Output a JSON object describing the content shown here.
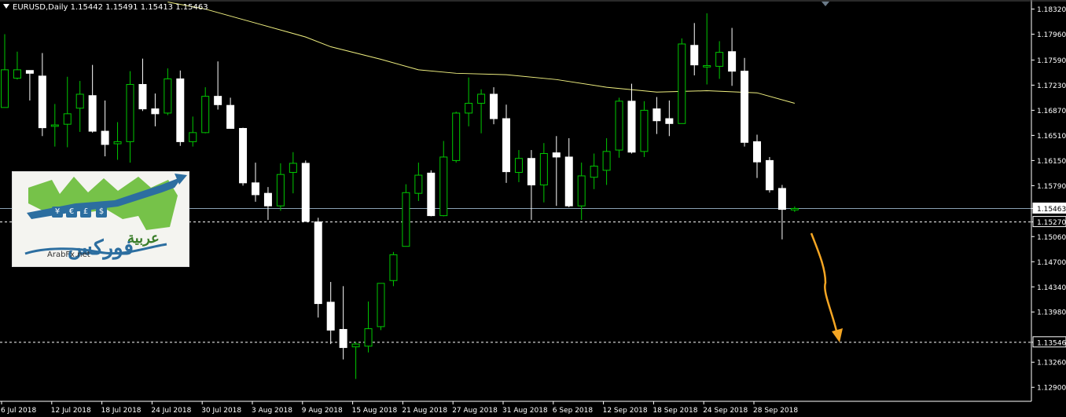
{
  "header": {
    "symbol": "EURUSD,Daily",
    "ohlc": "1.15442 1.15491 1.15413 1.15463"
  },
  "logo": {
    "arabic_top": "عربية",
    "arabic_main": "فوركس",
    "site": "ArabFx.net",
    "currency_symbols": [
      "¥",
      "€",
      "£",
      "$"
    ]
  },
  "colors": {
    "background": "#000000",
    "axis": "#ffffff",
    "bull_candle": "#000000",
    "bull_border": "#00c800",
    "bear_candle": "#ffffff",
    "ma_line": "#f0f080",
    "current_price_line": "#8aa0b4",
    "annotation_arrow": "#f5a623"
  },
  "chart_data": {
    "type": "candlestick",
    "ylim": [
      1.127,
      1.1845
    ],
    "y_tick_labels": [
      "1.18320",
      "1.17960",
      "1.17590",
      "1.17230",
      "1.16870",
      "1.16510",
      "1.16150",
      "1.15790",
      "1.15463",
      "1.15270",
      "1.15060",
      "1.14700",
      "1.14340",
      "1.13980",
      "1.13546",
      "1.13260",
      "1.12900"
    ],
    "y_tick_values": [
      1.1832,
      1.1796,
      1.1759,
      1.1723,
      1.1687,
      1.1651,
      1.1615,
      1.1579,
      1.15463,
      1.1527,
      1.1506,
      1.147,
      1.1434,
      1.1398,
      1.13546,
      1.1326,
      1.129
    ],
    "x_tick_labels": [
      "6 Jul 2018",
      "12 Jul 2018",
      "18 Jul 2018",
      "24 Jul 2018",
      "30 Jul 2018",
      "3 Aug 2018",
      "9 Aug 2018",
      "15 Aug 2018",
      "21 Aug 2018",
      "27 Aug 2018",
      "31 Aug 2018",
      "6 Sep 2018",
      "12 Sep 2018",
      "18 Sep 2018",
      "24 Sep 2018",
      "28 Sep 2018"
    ],
    "x_tick_index": [
      0,
      4,
      8,
      12,
      16,
      20,
      24,
      28,
      32,
      36,
      40,
      44,
      48,
      52,
      56,
      60
    ],
    "current_price": 1.15463,
    "horizontal_levels": [
      1.1527,
      1.13546
    ],
    "candles": [
      {
        "o": 1.1691,
        "h": 1.1796,
        "l": 1.1691,
        "c": 1.1745
      },
      {
        "o": 1.1733,
        "h": 1.1771,
        "l": 1.1731,
        "c": 1.1745
      },
      {
        "o": 1.1744,
        "h": 1.1744,
        "l": 1.1701,
        "c": 1.174
      },
      {
        "o": 1.1736,
        "h": 1.1769,
        "l": 1.165,
        "c": 1.1662
      },
      {
        "o": 1.1664,
        "h": 1.1696,
        "l": 1.1635,
        "c": 1.1666
      },
      {
        "o": 1.1667,
        "h": 1.1735,
        "l": 1.1634,
        "c": 1.1682
      },
      {
        "o": 1.169,
        "h": 1.1729,
        "l": 1.1656,
        "c": 1.171
      },
      {
        "o": 1.1708,
        "h": 1.1752,
        "l": 1.1655,
        "c": 1.1657
      },
      {
        "o": 1.1657,
        "h": 1.1701,
        "l": 1.1621,
        "c": 1.1638
      },
      {
        "o": 1.1639,
        "h": 1.167,
        "l": 1.1616,
        "c": 1.1642
      },
      {
        "o": 1.1642,
        "h": 1.1743,
        "l": 1.1612,
        "c": 1.1724
      },
      {
        "o": 1.1724,
        "h": 1.1761,
        "l": 1.1686,
        "c": 1.1689
      },
      {
        "o": 1.1689,
        "h": 1.1711,
        "l": 1.1664,
        "c": 1.1682
      },
      {
        "o": 1.1683,
        "h": 1.1747,
        "l": 1.168,
        "c": 1.1732
      },
      {
        "o": 1.1732,
        "h": 1.1744,
        "l": 1.1636,
        "c": 1.1642
      },
      {
        "o": 1.1642,
        "h": 1.1678,
        "l": 1.1635,
        "c": 1.1655
      },
      {
        "o": 1.1655,
        "h": 1.172,
        "l": 1.1654,
        "c": 1.1707
      },
      {
        "o": 1.1707,
        "h": 1.1757,
        "l": 1.1688,
        "c": 1.1695
      },
      {
        "o": 1.1694,
        "h": 1.1705,
        "l": 1.1662,
        "c": 1.1661
      },
      {
        "o": 1.1661,
        "h": 1.1662,
        "l": 1.1579,
        "c": 1.1583
      },
      {
        "o": 1.1583,
        "h": 1.1612,
        "l": 1.1556,
        "c": 1.1566
      },
      {
        "o": 1.1568,
        "h": 1.1577,
        "l": 1.153,
        "c": 1.155
      },
      {
        "o": 1.155,
        "h": 1.1611,
        "l": 1.1543,
        "c": 1.1595
      },
      {
        "o": 1.1598,
        "h": 1.1627,
        "l": 1.1568,
        "c": 1.1611
      },
      {
        "o": 1.1611,
        "h": 1.1615,
        "l": 1.1527,
        "c": 1.1528
      },
      {
        "o": 1.1527,
        "h": 1.1533,
        "l": 1.139,
        "c": 1.141
      },
      {
        "o": 1.1412,
        "h": 1.1441,
        "l": 1.1352,
        "c": 1.1372
      },
      {
        "o": 1.1373,
        "h": 1.1435,
        "l": 1.133,
        "c": 1.1347
      },
      {
        "o": 1.1348,
        "h": 1.1355,
        "l": 1.1302,
        "c": 1.1352
      },
      {
        "o": 1.1349,
        "h": 1.1413,
        "l": 1.134,
        "c": 1.1374
      },
      {
        "o": 1.1377,
        "h": 1.1439,
        "l": 1.1372,
        "c": 1.1439
      },
      {
        "o": 1.1443,
        "h": 1.1484,
        "l": 1.1435,
        "c": 1.148
      },
      {
        "o": 1.1492,
        "h": 1.1581,
        "l": 1.1492,
        "c": 1.1569
      },
      {
        "o": 1.1568,
        "h": 1.1612,
        "l": 1.1557,
        "c": 1.1594
      },
      {
        "o": 1.1597,
        "h": 1.1601,
        "l": 1.1535,
        "c": 1.1536
      },
      {
        "o": 1.1536,
        "h": 1.1643,
        "l": 1.1535,
        "c": 1.162
      },
      {
        "o": 1.1615,
        "h": 1.1685,
        "l": 1.1612,
        "c": 1.1683
      },
      {
        "o": 1.1683,
        "h": 1.1734,
        "l": 1.1664,
        "c": 1.1697
      },
      {
        "o": 1.1697,
        "h": 1.1717,
        "l": 1.1654,
        "c": 1.171
      },
      {
        "o": 1.171,
        "h": 1.172,
        "l": 1.1667,
        "c": 1.1675
      },
      {
        "o": 1.1675,
        "h": 1.1695,
        "l": 1.1583,
        "c": 1.1599
      },
      {
        "o": 1.1598,
        "h": 1.163,
        "l": 1.1584,
        "c": 1.1618
      },
      {
        "o": 1.1618,
        "h": 1.163,
        "l": 1.153,
        "c": 1.158
      },
      {
        "o": 1.158,
        "h": 1.164,
        "l": 1.1555,
        "c": 1.1625
      },
      {
        "o": 1.1626,
        "h": 1.165,
        "l": 1.155,
        "c": 1.162
      },
      {
        "o": 1.162,
        "h": 1.1647,
        "l": 1.1548,
        "c": 1.155
      },
      {
        "o": 1.155,
        "h": 1.1612,
        "l": 1.153,
        "c": 1.1593
      },
      {
        "o": 1.1591,
        "h": 1.1625,
        "l": 1.1574,
        "c": 1.1607
      },
      {
        "o": 1.1601,
        "h": 1.1647,
        "l": 1.158,
        "c": 1.1628
      },
      {
        "o": 1.163,
        "h": 1.1705,
        "l": 1.1619,
        "c": 1.17
      },
      {
        "o": 1.17,
        "h": 1.1725,
        "l": 1.1625,
        "c": 1.1627
      },
      {
        "o": 1.1628,
        "h": 1.17,
        "l": 1.162,
        "c": 1.1687
      },
      {
        "o": 1.1689,
        "h": 1.1706,
        "l": 1.1653,
        "c": 1.1672
      },
      {
        "o": 1.1675,
        "h": 1.1701,
        "l": 1.165,
        "c": 1.1668
      },
      {
        "o": 1.1668,
        "h": 1.179,
        "l": 1.1668,
        "c": 1.1782
      },
      {
        "o": 1.178,
        "h": 1.1812,
        "l": 1.1737,
        "c": 1.1752
      },
      {
        "o": 1.1749,
        "h": 1.1826,
        "l": 1.1724,
        "c": 1.1751
      },
      {
        "o": 1.175,
        "h": 1.1786,
        "l": 1.1732,
        "c": 1.177
      },
      {
        "o": 1.1771,
        "h": 1.1805,
        "l": 1.1722,
        "c": 1.1743
      },
      {
        "o": 1.1743,
        "h": 1.1762,
        "l": 1.1635,
        "c": 1.1641
      },
      {
        "o": 1.1642,
        "h": 1.1652,
        "l": 1.159,
        "c": 1.1613
      },
      {
        "o": 1.1615,
        "h": 1.162,
        "l": 1.1569,
        "c": 1.1573
      },
      {
        "o": 1.1575,
        "h": 1.158,
        "l": 1.1502,
        "c": 1.1545
      },
      {
        "o": 1.15442,
        "h": 1.15491,
        "l": 1.15413,
        "c": 1.15463
      }
    ],
    "moving_average": [
      {
        "i": 13,
        "v": 1.1842
      },
      {
        "i": 16,
        "v": 1.1832
      },
      {
        "i": 20,
        "v": 1.1812
      },
      {
        "i": 24,
        "v": 1.1792
      },
      {
        "i": 26,
        "v": 1.1778
      },
      {
        "i": 30,
        "v": 1.176
      },
      {
        "i": 33,
        "v": 1.1745
      },
      {
        "i": 36,
        "v": 1.174
      },
      {
        "i": 40,
        "v": 1.1738
      },
      {
        "i": 44,
        "v": 1.1731
      },
      {
        "i": 48,
        "v": 1.172
      },
      {
        "i": 52,
        "v": 1.1713
      },
      {
        "i": 56,
        "v": 1.1715
      },
      {
        "i": 60,
        "v": 1.1712
      },
      {
        "i": 63,
        "v": 1.1697
      }
    ]
  }
}
